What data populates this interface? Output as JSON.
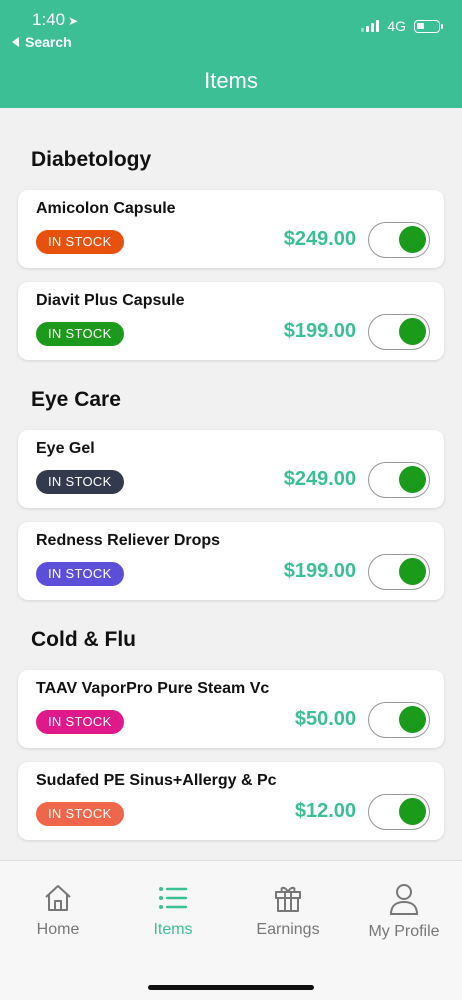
{
  "status": {
    "time": "1:40",
    "back_label": "Search",
    "network": "4G"
  },
  "header": {
    "title": "Items"
  },
  "sections": [
    {
      "title": "Diabetology",
      "items": [
        {
          "name": "Amicolon Capsule",
          "badge": "IN STOCK",
          "badge_color": "#e8510d",
          "price": "$249.00",
          "enabled": true
        },
        {
          "name": "Diavit Plus Capsule",
          "badge": "IN STOCK",
          "badge_color": "#1c9a1c",
          "price": "$199.00",
          "enabled": true
        }
      ]
    },
    {
      "title": "Eye Care",
      "items": [
        {
          "name": "Eye Gel",
          "badge": "IN STOCK",
          "badge_color": "#343a4d",
          "price": "$249.00",
          "enabled": true
        },
        {
          "name": "Redness Reliever Drops",
          "badge": "IN STOCK",
          "badge_color": "#5b4fd9",
          "price": "$199.00",
          "enabled": true
        }
      ]
    },
    {
      "title": "Cold & Flu",
      "items": [
        {
          "name": "TAAV VaporPro Pure Steam Vc",
          "badge": "IN STOCK",
          "badge_color": "#e0198a",
          "price": "$50.00",
          "enabled": true
        },
        {
          "name": "Sudafed PE Sinus+Allergy & Pc",
          "badge": "IN STOCK",
          "badge_color": "#f0664a",
          "price": "$12.00",
          "enabled": true
        }
      ]
    }
  ],
  "tabs": [
    {
      "label": "Home",
      "icon": "home-icon",
      "active": false
    },
    {
      "label": "Items",
      "icon": "list-icon",
      "active": true
    },
    {
      "label": "Earnings",
      "icon": "gift-icon",
      "active": false
    },
    {
      "label": "My Profile",
      "icon": "user-icon",
      "active": false
    }
  ],
  "colors": {
    "accent": "#3dbf96",
    "toggle_on": "#1a9c1a"
  }
}
